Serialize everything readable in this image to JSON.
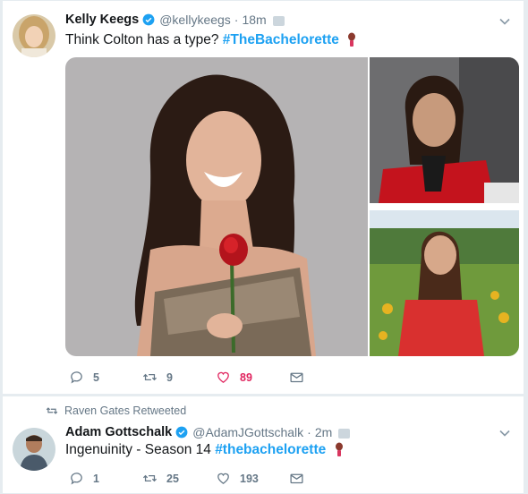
{
  "colors": {
    "link": "#1da1f2",
    "muted": "#657786",
    "like": "#e0245e",
    "verified": "#1da1f2"
  },
  "tweets": [
    {
      "name": "Kelly Keegs",
      "handle": "@kellykeegs",
      "dot": "·",
      "time": "18m",
      "text": "Think Colton has a type?",
      "hashtag": "#TheBachelorette",
      "replies": "5",
      "retweets": "9",
      "likes": "89"
    },
    {
      "context": "Raven Gates Retweeted",
      "name": "Adam Gottschalk",
      "handle": "@AdamJGottschalk",
      "dot": "·",
      "time": "2m",
      "text": "Ingenuinity - Season 14",
      "hashtag": "#thebachelorette",
      "replies": "1",
      "retweets": "25",
      "likes": "193"
    }
  ],
  "icons": [
    "verified-icon",
    "caret-down-icon",
    "reply-icon",
    "retweet-icon",
    "heart-icon",
    "envelope-icon",
    "rose-emoji-icon"
  ]
}
